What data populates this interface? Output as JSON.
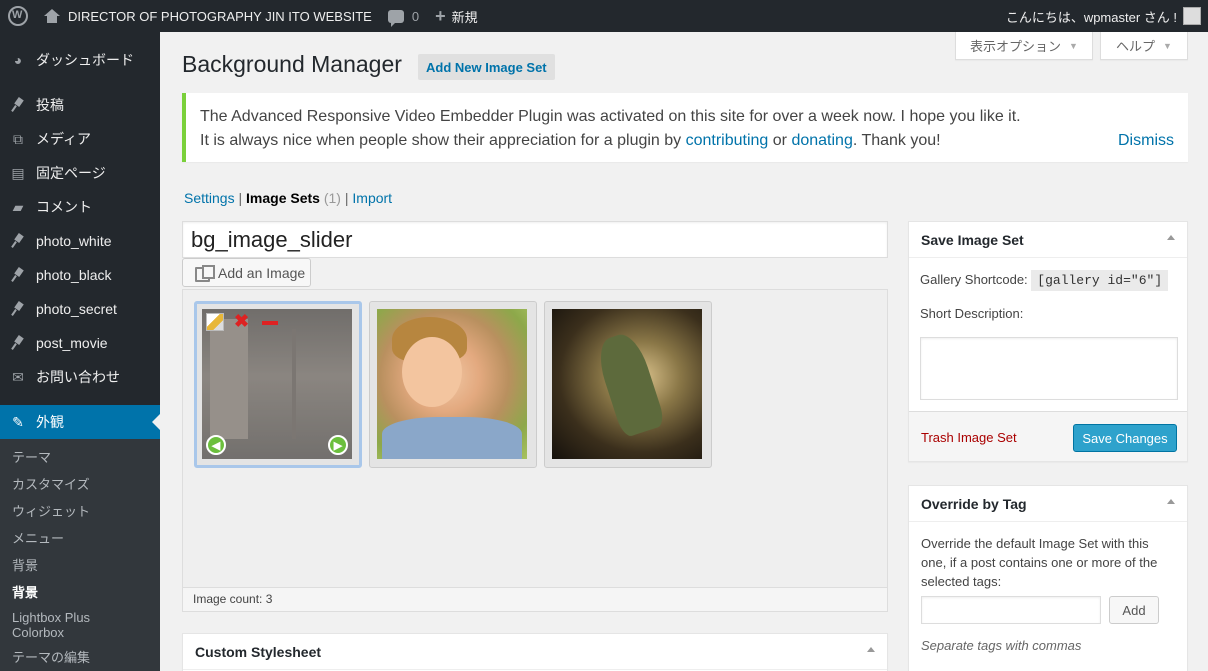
{
  "adminbar": {
    "site_name": "DIRECTOR OF PHOTOGRAPHY JIN ITO WEBSITE",
    "comments_count": "0",
    "new_label": "新規",
    "greeting": "こんにちは、wpmaster さん !"
  },
  "sidebar": {
    "items": [
      {
        "label": "ダッシュボード",
        "icon": "dashboard-icon"
      },
      {
        "label": "投稿",
        "icon": "pin-icon"
      },
      {
        "label": "メディア",
        "icon": "media-icon"
      },
      {
        "label": "固定ページ",
        "icon": "page-icon"
      },
      {
        "label": "コメント",
        "icon": "comment-icon"
      },
      {
        "label": "photo_white",
        "icon": "pin-icon"
      },
      {
        "label": "photo_black",
        "icon": "pin-icon"
      },
      {
        "label": "photo_secret",
        "icon": "pin-icon"
      },
      {
        "label": "post_movie",
        "icon": "pin-icon"
      },
      {
        "label": "お問い合わせ",
        "icon": "mail-icon"
      },
      {
        "label": "外観",
        "icon": "brush-icon"
      }
    ],
    "submenu": [
      "テーマ",
      "カスタマイズ",
      "ウィジェット",
      "メニュー",
      "背景",
      "背景",
      "Lightbox Plus Colorbox",
      "テーマの編集"
    ]
  },
  "screen_options": {
    "display_label": "表示オプション",
    "help_label": "ヘルプ"
  },
  "page": {
    "title": "Background Manager",
    "add_new": "Add New Image Set"
  },
  "notice": {
    "line1": "The Advanced Responsive Video Embedder Plugin was activated on this site for over a week now. I hope you like it.",
    "line2_a": "It is always nice when people show their appreciation for a plugin by ",
    "link_contributing": "contributing",
    "or": " or ",
    "link_donating": "donating",
    "line2_b": ". Thank you!",
    "dismiss": "Dismiss"
  },
  "subnav": {
    "settings": "Settings",
    "image_sets": "Image Sets",
    "image_sets_count": "(1)",
    "import": "Import",
    "sep": "|"
  },
  "editor": {
    "title_value": "bg_image_slider",
    "add_image": "Add an Image",
    "image_count": "Image count: 3"
  },
  "save_box": {
    "title": "Save Image Set",
    "shortcode_label": "Gallery Shortcode:",
    "shortcode_value": "[gallery id=\"6\"]",
    "short_desc_label": "Short Description:",
    "trash": "Trash Image Set",
    "save": "Save Changes"
  },
  "tag_box": {
    "title": "Override by Tag",
    "description": "Override the default Image Set with this one, if a post contains one or more of the selected tags:",
    "add": "Add",
    "hint": "Separate tags with commas"
  },
  "css_box": {
    "title": "Custom Stylesheet"
  },
  "colors": {
    "accent": "#0073aa",
    "sidebar": "#23282d",
    "notice": "#7ad03a",
    "primary_button": "#2ea2cc",
    "trash": "#aa0000"
  }
}
